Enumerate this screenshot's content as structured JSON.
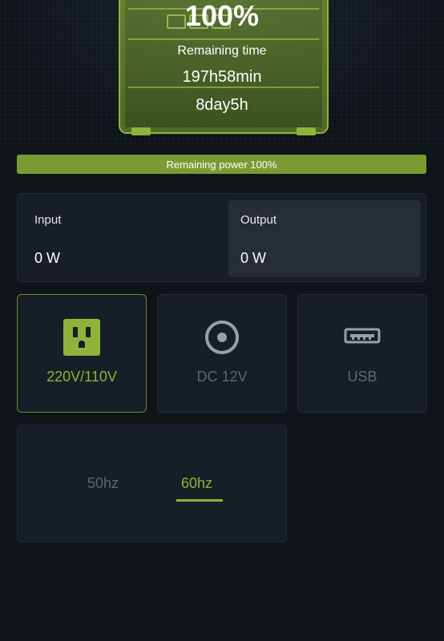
{
  "status": {
    "battery_percent": "100%",
    "remaining_time_label": "Remaining time",
    "remaining_hours": "197h58min",
    "remaining_days": "8day5h"
  },
  "power_bar": {
    "label": "Remaining power 100%",
    "level": 1.0,
    "color": "#7c9a32"
  },
  "io": {
    "input_label": "Input",
    "input_value": "0 W",
    "output_label": "Output",
    "output_value": "0 W"
  },
  "modes": [
    {
      "label": "220V/110V",
      "icon": "ac-outlet-icon",
      "active": true
    },
    {
      "label": "DC 12V",
      "icon": "dc-port-icon",
      "active": false
    },
    {
      "label": "USB",
      "icon": "usb-icon",
      "active": false
    }
  ],
  "frequency": {
    "options": [
      "50hz",
      "60hz"
    ],
    "selected": "60hz"
  },
  "colors": {
    "accent": "#8fb33a",
    "background": "#0f1419",
    "card": "#171e27"
  }
}
